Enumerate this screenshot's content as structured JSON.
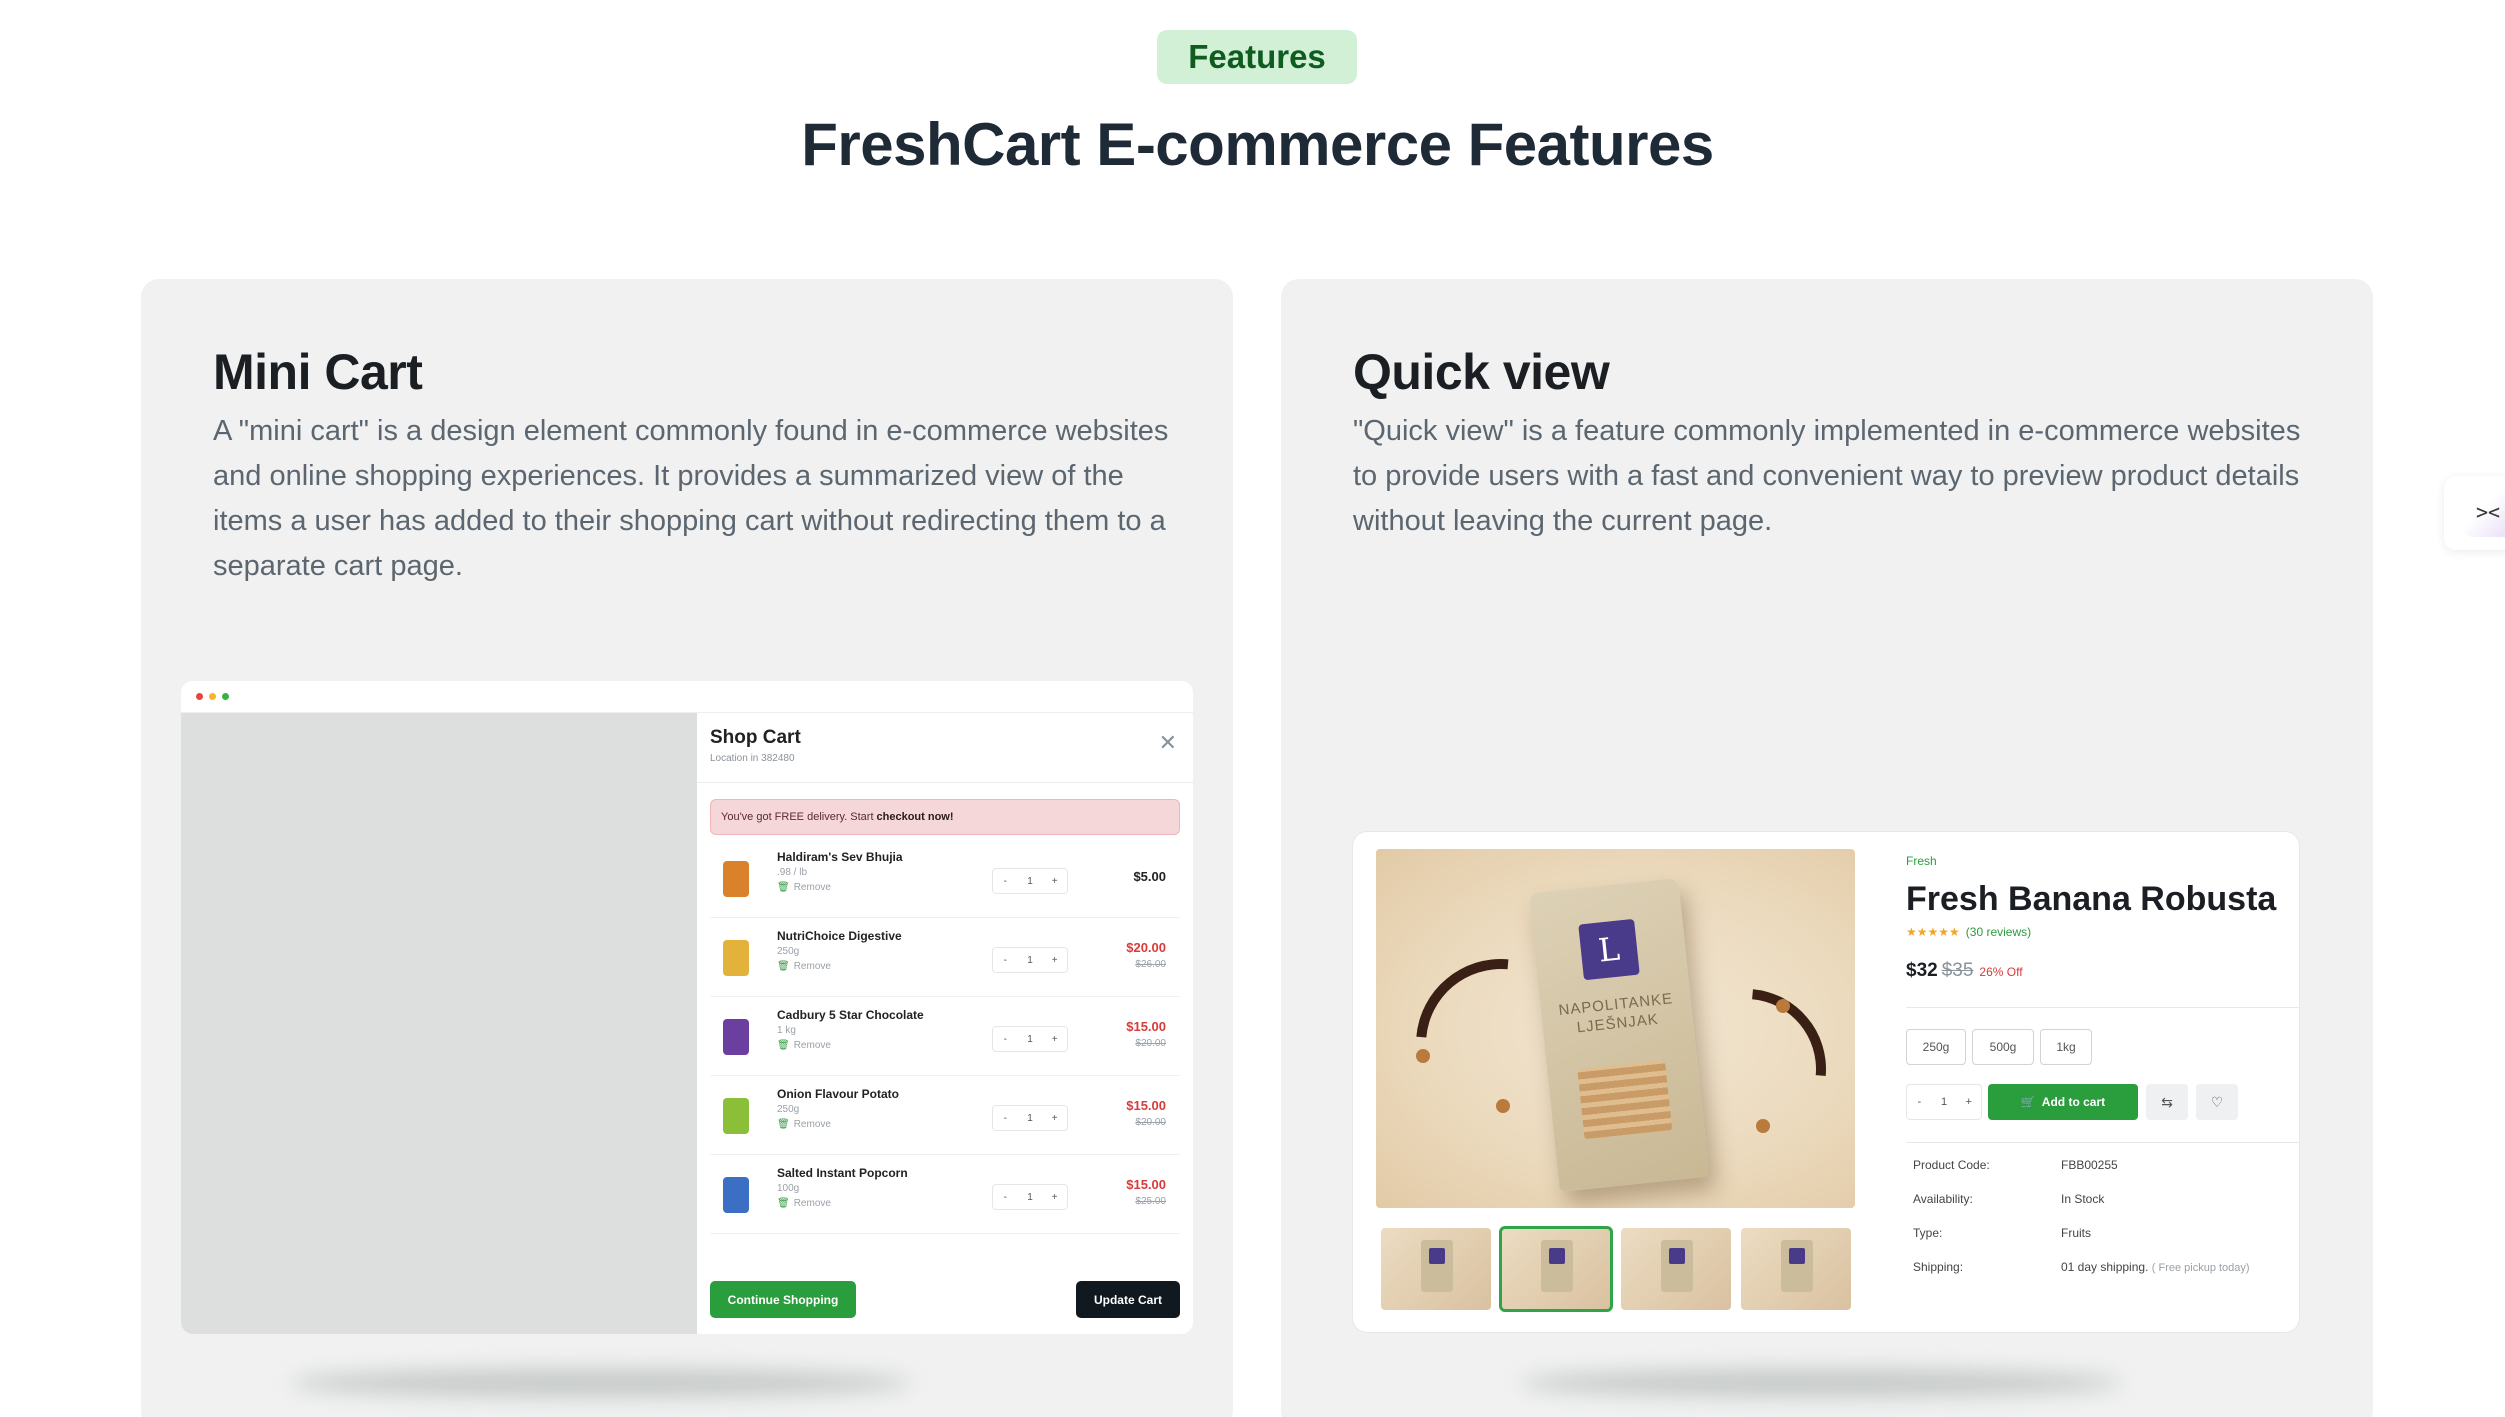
{
  "header": {
    "badge": "Features",
    "title": "FreshCart E-commerce Features"
  },
  "cards": [
    {
      "title": "Mini Cart",
      "description": "A \"mini cart\" is a design element commonly found in e-commerce websites and online shopping experiences. It provides a summarized view of the items a user has added to their shopping cart without redirecting them to a separate cart page."
    },
    {
      "title": "Quick view",
      "description": "\"Quick view\" is a feature commonly implemented in e-commerce websites to provide users with a fast and convenient way to preview product details without leaving the current page."
    }
  ],
  "mini_cart": {
    "title": "Shop Cart",
    "location": "Location in 382480",
    "banner_text": "You've got FREE delivery. Start",
    "banner_link": "checkout now!",
    "remove_label": "Remove",
    "items": [
      {
        "name": "Haldiram's Sev Bhujia",
        "weight": ".98 / lb",
        "qty": "1",
        "price": "$5.00",
        "old_price": "",
        "thumb_color": "#d9822b"
      },
      {
        "name": "NutriChoice Digestive",
        "weight": "250g",
        "qty": "1",
        "price": "$20.00",
        "old_price": "$26.00",
        "thumb_color": "#e2b23a"
      },
      {
        "name": "Cadbury 5 Star Chocolate",
        "weight": "1 kg",
        "qty": "1",
        "price": "$15.00",
        "old_price": "$20.00",
        "thumb_color": "#6b3fa0"
      },
      {
        "name": "Onion Flavour Potato",
        "weight": "250g",
        "qty": "1",
        "price": "$15.00",
        "old_price": "$20.00",
        "thumb_color": "#8bbf3a"
      },
      {
        "name": "Salted Instant Popcorn",
        "weight": "100g",
        "qty": "1",
        "price": "$15.00",
        "old_price": "$25.00",
        "thumb_color": "#3a6fc4"
      }
    ],
    "continue_label": "Continue Shopping",
    "update_label": "Update Cart",
    "window_dots": [
      "#e8453c",
      "#f5b52e",
      "#35b34a"
    ]
  },
  "quick_view": {
    "category": "Fresh",
    "product_name": "Fresh Banana Robusta",
    "stars": "★★★★★",
    "reviews": "(30 reviews)",
    "price": "$32",
    "old_price": "$35",
    "discount": "26% Off",
    "sizes": [
      "250g",
      "500g",
      "1kg"
    ],
    "qty": "1",
    "add_to_cart": "Add to cart",
    "package_brand": "L",
    "package_text": "NAPOLITANKE LJEŠNJAK",
    "meta": [
      {
        "label": "Product Code:",
        "value": "FBB00255",
        "note": ""
      },
      {
        "label": "Availability:",
        "value": "In Stock",
        "note": ""
      },
      {
        "label": "Type:",
        "value": "Fruits",
        "note": ""
      },
      {
        "label": "Shipping:",
        "value": "01 day shipping.",
        "note": "( Free pickup today)"
      }
    ]
  },
  "colors": {
    "accent_green": "#2a9d3c",
    "badge_bg": "#d1f0d6",
    "card_bg": "#f0f1f0",
    "sale_red": "#d83b3b"
  },
  "icons": {
    "side_tab": "code-icon",
    "close": "close-icon",
    "remove": "trash-icon",
    "compare": "compare-icon",
    "wishlist": "heart-icon"
  }
}
